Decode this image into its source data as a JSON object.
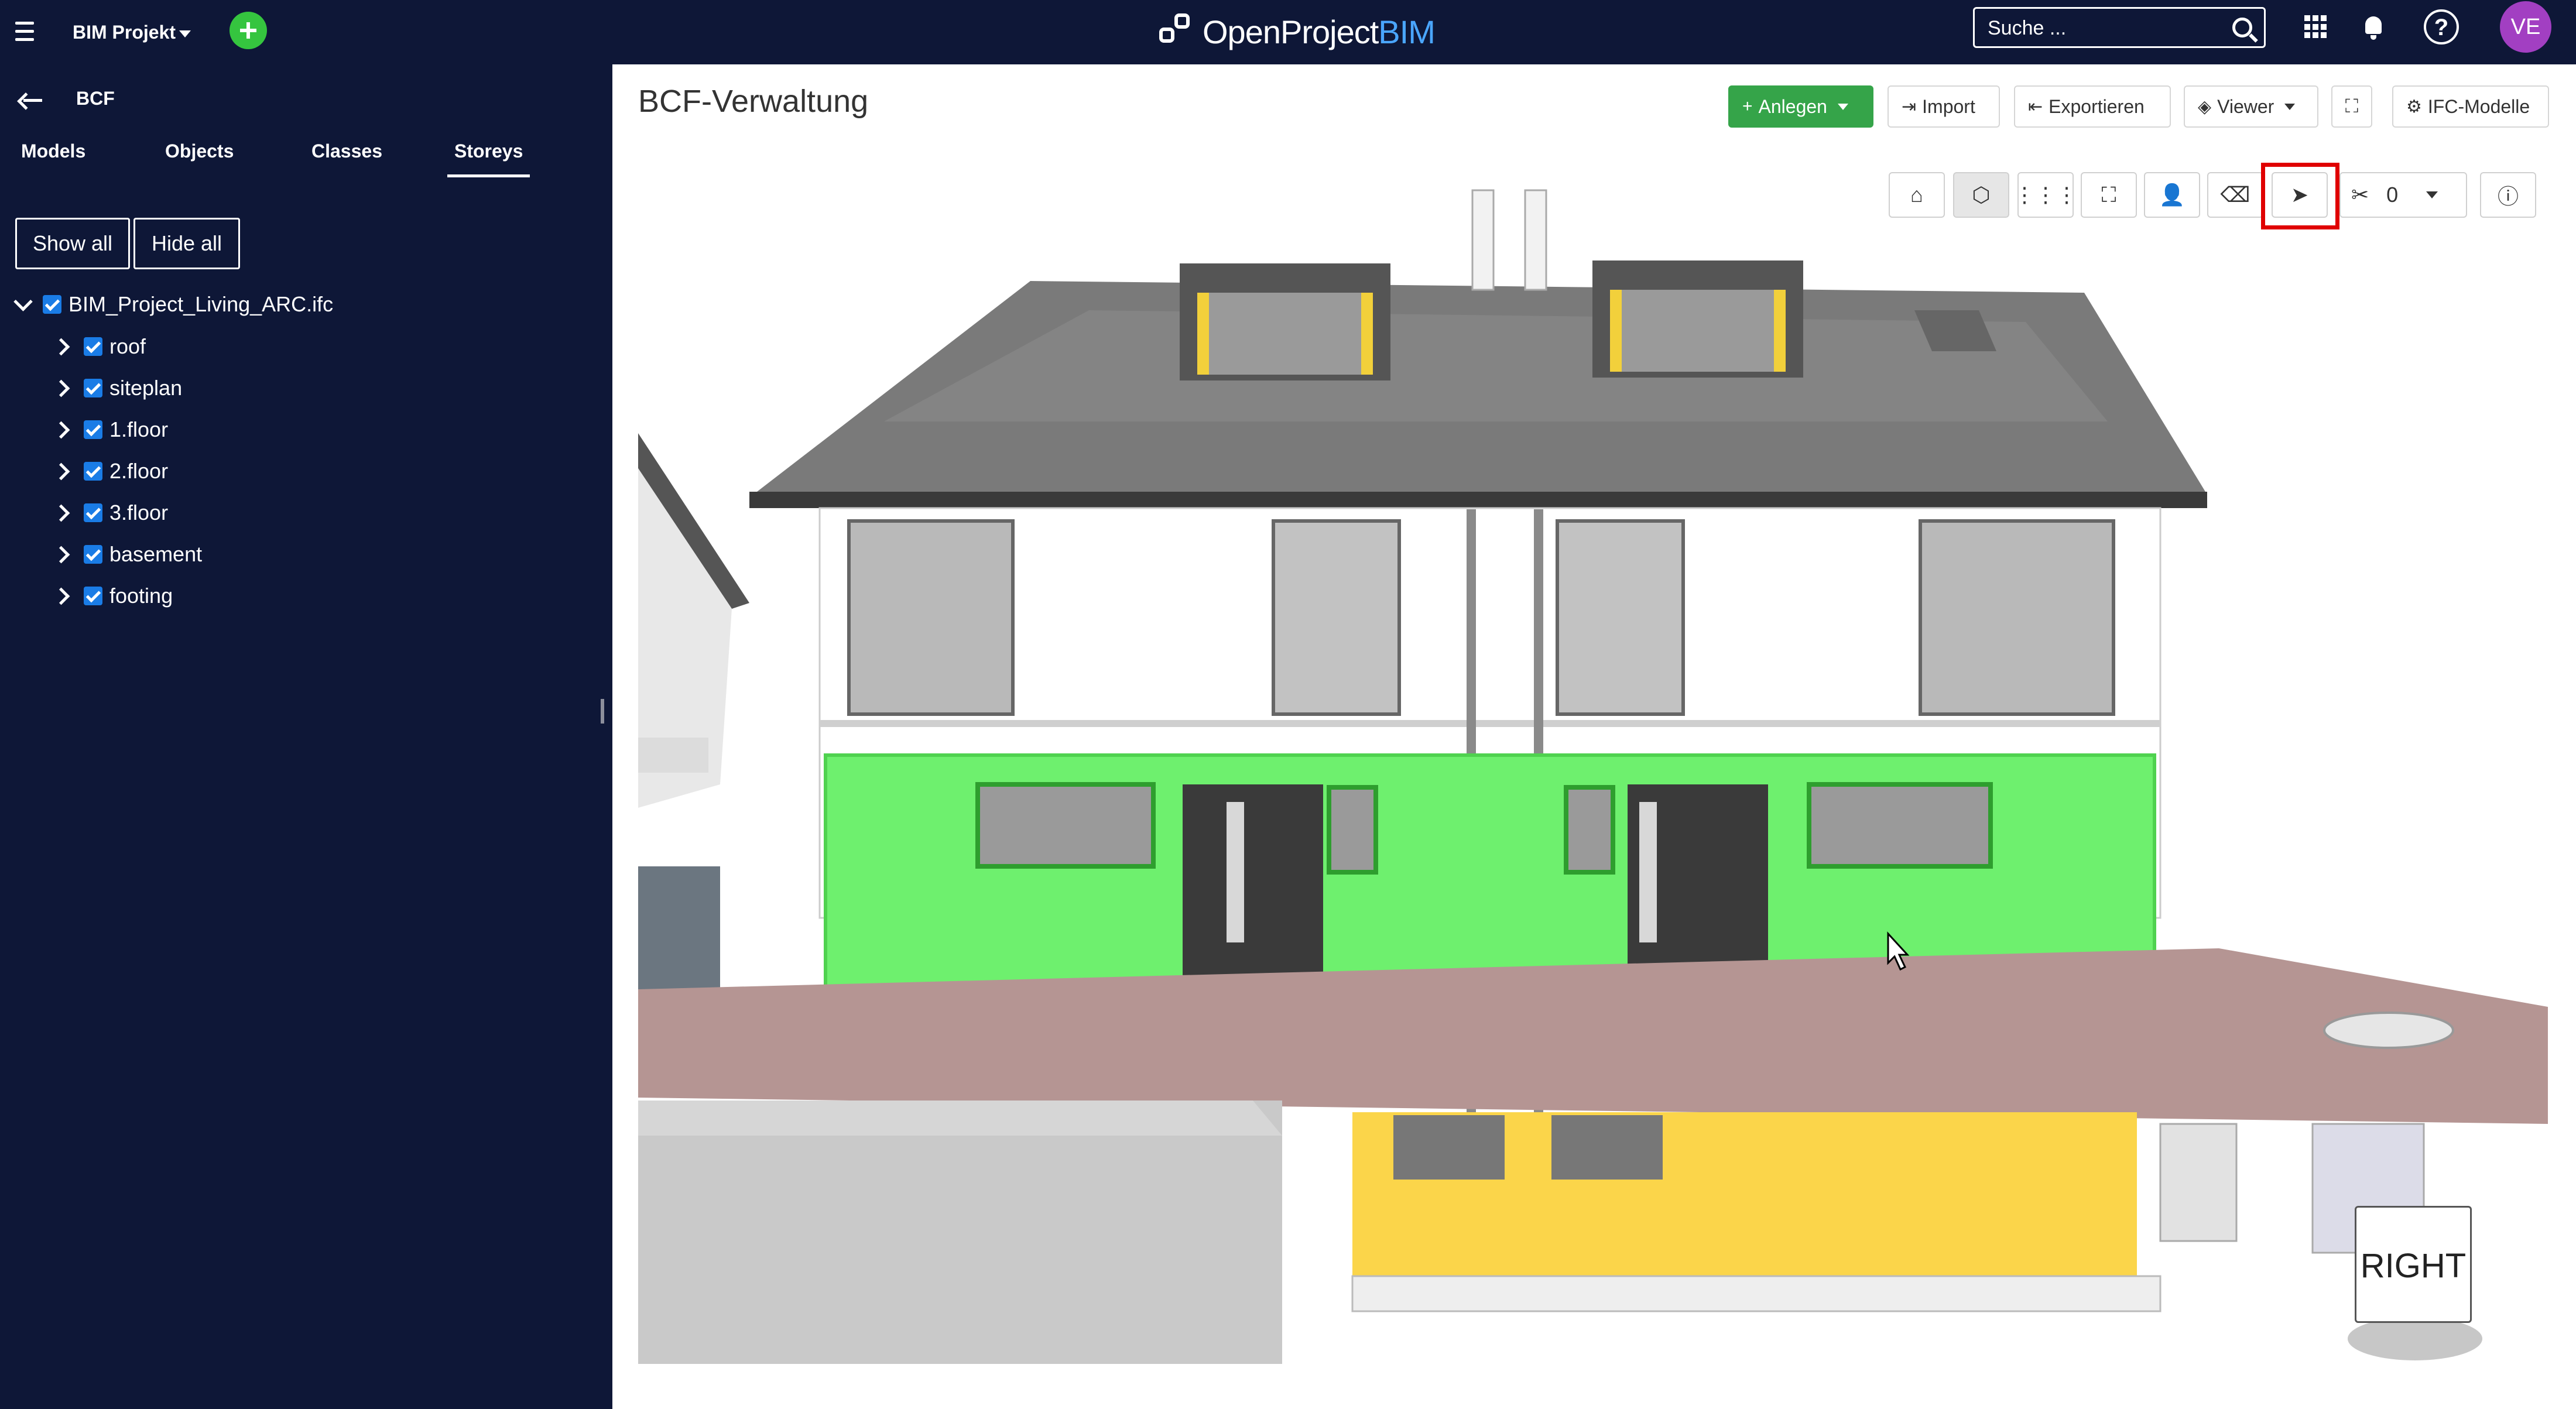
{
  "topbar": {
    "project_name": "BIM Projekt",
    "logo_text_main": "OpenProject",
    "logo_text_accent": "BIM",
    "search_placeholder": "Suche ...",
    "avatar_initials": "VE",
    "help_glyph": "?"
  },
  "sidebar": {
    "section_title": "BCF",
    "tabs": [
      {
        "label": "Models"
      },
      {
        "label": "Objects"
      },
      {
        "label": "Classes"
      },
      {
        "label": "Storeys",
        "active": true
      }
    ],
    "show_all_label": "Show all",
    "hide_all_label": "Hide all",
    "model_file": "BIM_Project_Living_ARC.ifc",
    "storeys": [
      {
        "label": "roof"
      },
      {
        "label": "siteplan"
      },
      {
        "label": "1.floor"
      },
      {
        "label": "2.floor"
      },
      {
        "label": "3.floor"
      },
      {
        "label": "basement"
      },
      {
        "label": "footing"
      }
    ]
  },
  "main": {
    "title": "BCF-Verwaltung",
    "toolbar": {
      "create_label": "Anlegen",
      "import_label": "Import",
      "export_label": "Exportieren",
      "viewer_label": "Viewer",
      "ifc_models_label": "IFC-Modelle"
    },
    "viewer_toolbar": {
      "section_count": "0",
      "nav_cube_label": "RIGHT",
      "icons": [
        "home-icon",
        "cube-icon",
        "grid-icon",
        "fit-icon",
        "person-icon",
        "eraser-icon",
        "pointer-icon",
        "scissors-icon",
        "info-icon"
      ]
    }
  },
  "colors": {
    "navbar_bg": "#0e1737",
    "sidebar_bg": "#0e1737",
    "accent_green": "#35a449",
    "add_button_green": "#35c53f",
    "checkbox_blue": "#1a7ce6",
    "avatar_purple": "#a23fc2",
    "highlight_red": "#e00000",
    "selected_storey_green": "#6ef06e"
  }
}
